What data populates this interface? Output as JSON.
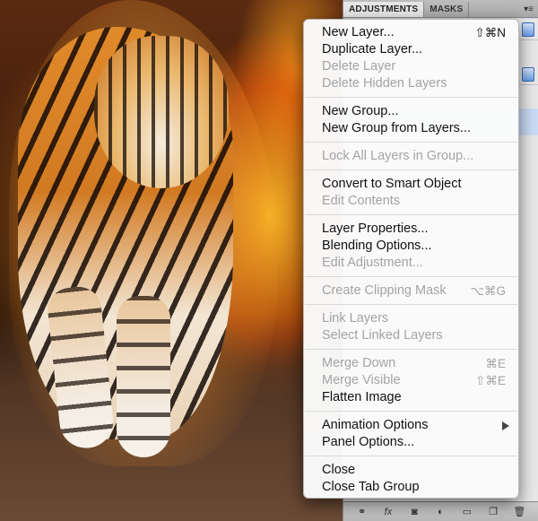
{
  "panel": {
    "tabs": [
      {
        "label": "ADJUSTMENTS",
        "active": true
      },
      {
        "label": "MASKS",
        "active": false
      }
    ],
    "menu_button_icon": "panel-menu-icon",
    "footer_icons": [
      "link-icon",
      "fx-icon",
      "mask-icon",
      "adjustment-icon",
      "group-folder-icon",
      "new-layer-icon",
      "trash-icon"
    ]
  },
  "menu": {
    "sections": [
      [
        {
          "label": "New Layer...",
          "shortcut": "⇧⌘N",
          "enabled": true
        },
        {
          "label": "Duplicate Layer...",
          "enabled": true
        },
        {
          "label": "Delete Layer",
          "enabled": false
        },
        {
          "label": "Delete Hidden Layers",
          "enabled": false
        }
      ],
      [
        {
          "label": "New Group...",
          "enabled": true
        },
        {
          "label": "New Group from Layers...",
          "enabled": true
        }
      ],
      [
        {
          "label": "Lock All Layers in Group...",
          "enabled": false
        }
      ],
      [
        {
          "label": "Convert to Smart Object",
          "enabled": true
        },
        {
          "label": "Edit Contents",
          "enabled": false
        }
      ],
      [
        {
          "label": "Layer Properties...",
          "enabled": true
        },
        {
          "label": "Blending Options...",
          "enabled": true
        },
        {
          "label": "Edit Adjustment...",
          "enabled": false
        }
      ],
      [
        {
          "label": "Create Clipping Mask",
          "shortcut": "⌥⌘G",
          "enabled": false
        }
      ],
      [
        {
          "label": "Link Layers",
          "enabled": false
        },
        {
          "label": "Select Linked Layers",
          "enabled": false
        }
      ],
      [
        {
          "label": "Merge Down",
          "shortcut": "⌘E",
          "enabled": false
        },
        {
          "label": "Merge Visible",
          "shortcut": "⇧⌘E",
          "enabled": false
        },
        {
          "label": "Flatten Image",
          "enabled": true
        }
      ],
      [
        {
          "label": "Animation Options",
          "submenu": true,
          "enabled": true
        },
        {
          "label": "Panel Options...",
          "enabled": true
        }
      ],
      [
        {
          "label": "Close",
          "enabled": true
        },
        {
          "label": "Close Tab Group",
          "enabled": true
        }
      ]
    ]
  },
  "colors": {
    "menu_text": "#111111",
    "menu_disabled_text": "#a3a3a3",
    "panel_bg": "#d6d6d6"
  }
}
